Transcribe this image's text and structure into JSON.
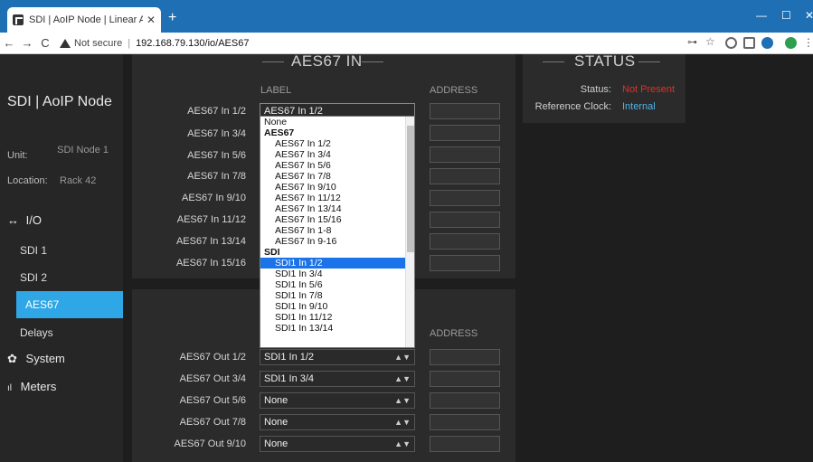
{
  "browser": {
    "tab_title": "SDI | AoIP Node | Linear Acoustic",
    "new_tab": "+",
    "security": "Not secure",
    "url": "192.168.79.130/io/AES67",
    "back": "←",
    "forward": "→",
    "reload": "C"
  },
  "sidebar": {
    "title": "SDI | AoIP Node",
    "unit_label": "Unit:",
    "unit_value": "SDI Node 1",
    "location_label": "Location:",
    "location_value": "Rack 42",
    "io_label": "I/O",
    "io_icon": "↔",
    "items": [
      "SDI 1",
      "SDI 2",
      "AES67",
      "Delays"
    ],
    "system_label": "System",
    "meters_label": "Meters"
  },
  "aes_in": {
    "title": "AES67 IN",
    "label_header": "LABEL",
    "address_header": "ADDRESS",
    "rows": [
      "AES67 In 1/2",
      "AES67 In 3/4",
      "AES67 In 5/6",
      "AES67 In 7/8",
      "AES67 In 9/10",
      "AES67 In 11/12",
      "AES67 In 13/14",
      "AES67 In 15/16"
    ],
    "first_value": "AES67 In 1/2"
  },
  "dropdown": {
    "items": [
      {
        "text": "None",
        "kind": "plain"
      },
      {
        "text": "AES67",
        "kind": "group"
      },
      {
        "text": "AES67 In 1/2",
        "kind": "opt"
      },
      {
        "text": "AES67 In 3/4",
        "kind": "opt"
      },
      {
        "text": "AES67 In 5/6",
        "kind": "opt"
      },
      {
        "text": "AES67 In 7/8",
        "kind": "opt"
      },
      {
        "text": "AES67 In 9/10",
        "kind": "opt"
      },
      {
        "text": "AES67 In 11/12",
        "kind": "opt"
      },
      {
        "text": "AES67 In 13/14",
        "kind": "opt"
      },
      {
        "text": "AES67 In 15/16",
        "kind": "opt"
      },
      {
        "text": "AES67 In 1-8",
        "kind": "opt"
      },
      {
        "text": "AES67 In 9-16",
        "kind": "opt"
      },
      {
        "text": "SDI",
        "kind": "group"
      },
      {
        "text": "SDI1 In 1/2",
        "kind": "opt",
        "selected": true
      },
      {
        "text": "SDI1 In 3/4",
        "kind": "opt"
      },
      {
        "text": "SDI1 In 5/6",
        "kind": "opt"
      },
      {
        "text": "SDI1 In 7/8",
        "kind": "opt"
      },
      {
        "text": "SDI1 In 9/10",
        "kind": "opt"
      },
      {
        "text": "SDI1 In 11/12",
        "kind": "opt"
      },
      {
        "text": "SDI1 In 13/14",
        "kind": "opt"
      }
    ]
  },
  "aes_out": {
    "address_header": "ADDRESS",
    "rows": [
      {
        "label": "AES67 Out 1/2",
        "value": "SDI1 In 1/2"
      },
      {
        "label": "AES67 Out 3/4",
        "value": "SDI1 In 3/4"
      },
      {
        "label": "AES67 Out 5/6",
        "value": "None"
      },
      {
        "label": "AES67 Out 7/8",
        "value": "None"
      },
      {
        "label": "AES67 Out 9/10",
        "value": "None"
      }
    ]
  },
  "status": {
    "title": "STATUS",
    "status_label": "Status:",
    "status_value": "Not Present",
    "clock_label": "Reference Clock:",
    "clock_value": "Internal"
  },
  "colors": {
    "accent": "#2fa7e6",
    "not_present": "#e0302a",
    "internal": "#4fb3e8"
  }
}
